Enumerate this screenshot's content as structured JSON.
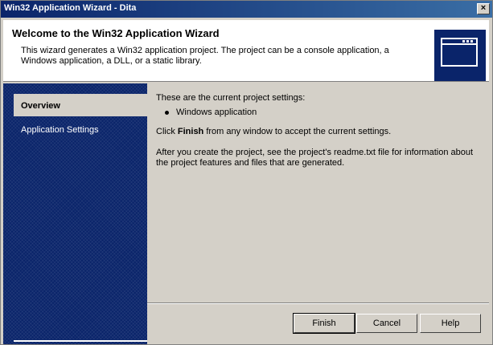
{
  "window": {
    "title": "Win32 Application Wizard - Dita",
    "close_label": "×"
  },
  "banner": {
    "heading": "Welcome to the Win32 Application Wizard",
    "description": "This wizard generates a Win32 application project. The project can be a console application, a Windows application, a DLL, or a static library."
  },
  "sidebar": {
    "items": [
      {
        "label": "Overview",
        "active": true
      },
      {
        "label": "Application Settings",
        "active": false
      }
    ]
  },
  "content": {
    "intro": "These are the current project settings:",
    "settings": [
      "Windows application"
    ],
    "finish_pre": "Click ",
    "finish_bold": "Finish",
    "finish_post": " from any window to accept the current settings.",
    "after": "After you create the project, see the project's readme.txt file for information about the project features and files that are generated."
  },
  "buttons": {
    "finish": "Finish",
    "cancel": "Cancel",
    "help": "Help"
  },
  "colors": {
    "accent": "#0a246a",
    "face": "#d4d0c8"
  }
}
